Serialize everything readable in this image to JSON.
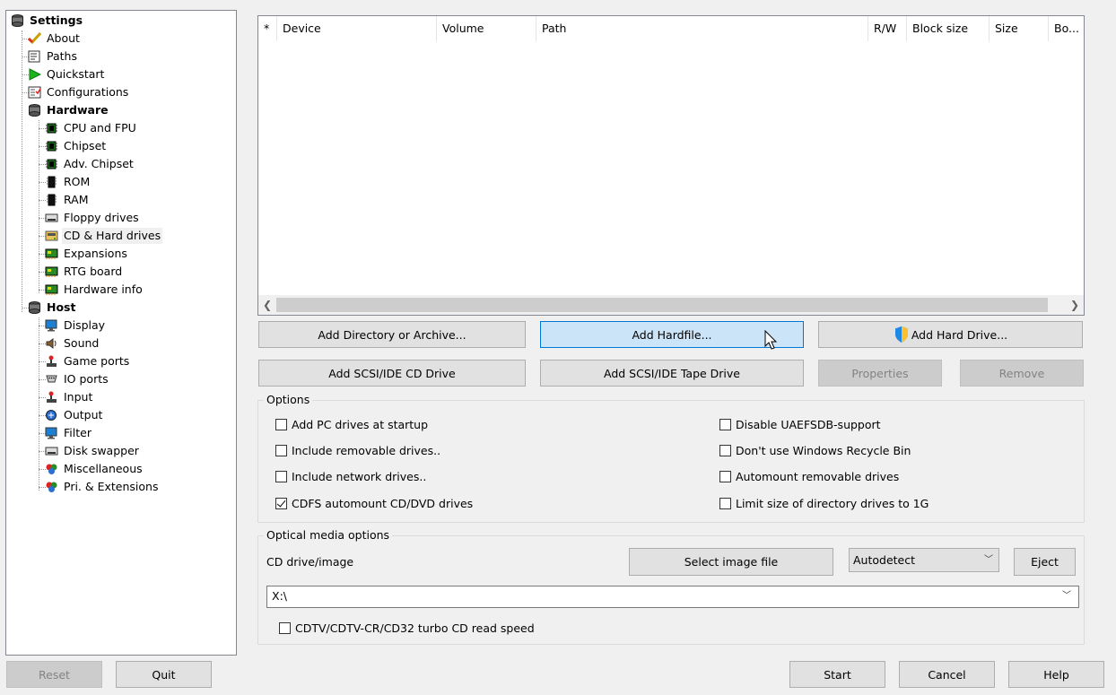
{
  "tree": {
    "root_label": "Settings",
    "items": [
      {
        "label": "About",
        "icon": "check-icon"
      },
      {
        "label": "Paths",
        "icon": "paths-icon"
      },
      {
        "label": "Quickstart",
        "icon": "play-icon"
      },
      {
        "label": "Configurations",
        "icon": "config-icon"
      }
    ],
    "hardware": {
      "label": "Hardware",
      "items": [
        {
          "label": "CPU and FPU",
          "icon": "chip-icon"
        },
        {
          "label": "Chipset",
          "icon": "chip-icon"
        },
        {
          "label": "Adv. Chipset",
          "icon": "chip-icon"
        },
        {
          "label": "ROM",
          "icon": "rom-icon"
        },
        {
          "label": "RAM",
          "icon": "ram-icon"
        },
        {
          "label": "Floppy drives",
          "icon": "floppy-icon"
        },
        {
          "label": "CD & Hard drives",
          "icon": "harddrive-icon"
        },
        {
          "label": "Expansions",
          "icon": "expansion-card-icon"
        },
        {
          "label": "RTG board",
          "icon": "expansion-card-icon"
        },
        {
          "label": "Hardware info",
          "icon": "expansion-card-icon"
        }
      ]
    },
    "host": {
      "label": "Host",
      "items": [
        {
          "label": "Display",
          "icon": "monitor-icon"
        },
        {
          "label": "Sound",
          "icon": "speaker-icon"
        },
        {
          "label": "Game ports",
          "icon": "joystick-icon"
        },
        {
          "label": "IO ports",
          "icon": "io-port-icon"
        },
        {
          "label": "Input",
          "icon": "joystick-icon"
        },
        {
          "label": "Output",
          "icon": "output-icon"
        },
        {
          "label": "Filter",
          "icon": "monitor-icon"
        },
        {
          "label": "Disk swapper",
          "icon": "floppy-icon"
        },
        {
          "label": "Miscellaneous",
          "icon": "misc-icon"
        },
        {
          "label": "Pri. & Extensions",
          "icon": "misc-icon"
        }
      ]
    }
  },
  "list": {
    "columns": [
      "*",
      "Device",
      "Volume",
      "Path",
      "R/W",
      "Block size",
      "Size",
      "Bo..."
    ]
  },
  "buttons": {
    "add_directory": "Add Directory or Archive...",
    "add_hardfile": "Add Hardfile...",
    "add_hard_drive": "Add Hard Drive...",
    "add_cd_drive": "Add SCSI/IDE CD Drive",
    "add_tape_drive": "Add SCSI/IDE Tape Drive",
    "properties": "Properties",
    "remove": "Remove"
  },
  "options": {
    "title": "Options",
    "left": [
      {
        "label": "Add PC drives at startup",
        "checked": false
      },
      {
        "label": "Include removable drives..",
        "checked": false
      },
      {
        "label": "Include network drives..",
        "checked": false
      },
      {
        "label": "CDFS automount CD/DVD drives",
        "checked": true
      }
    ],
    "right": [
      {
        "label": "Disable UAEFSDB-support",
        "checked": false
      },
      {
        "label": "Don't use Windows Recycle Bin",
        "checked": false
      },
      {
        "label": "Automount removable drives",
        "checked": false
      },
      {
        "label": "Limit size of directory drives to 1G",
        "checked": false
      }
    ]
  },
  "optical": {
    "title": "Optical media options",
    "cd_label": "CD drive/image",
    "select_image": "Select image file",
    "mode_value": "Autodetect",
    "eject": "Eject",
    "path_value": "X:\\",
    "turbo_label": "CDTV/CDTV-CR/CD32 turbo CD read speed",
    "turbo_checked": false
  },
  "footer": {
    "reset": "Reset",
    "quit": "Quit",
    "start": "Start",
    "cancel": "Cancel",
    "help": "Help"
  },
  "colors": {
    "focus_border": "#0078d7",
    "focus_fill": "#cce4f7",
    "window_bg": "#f0f0f0"
  }
}
